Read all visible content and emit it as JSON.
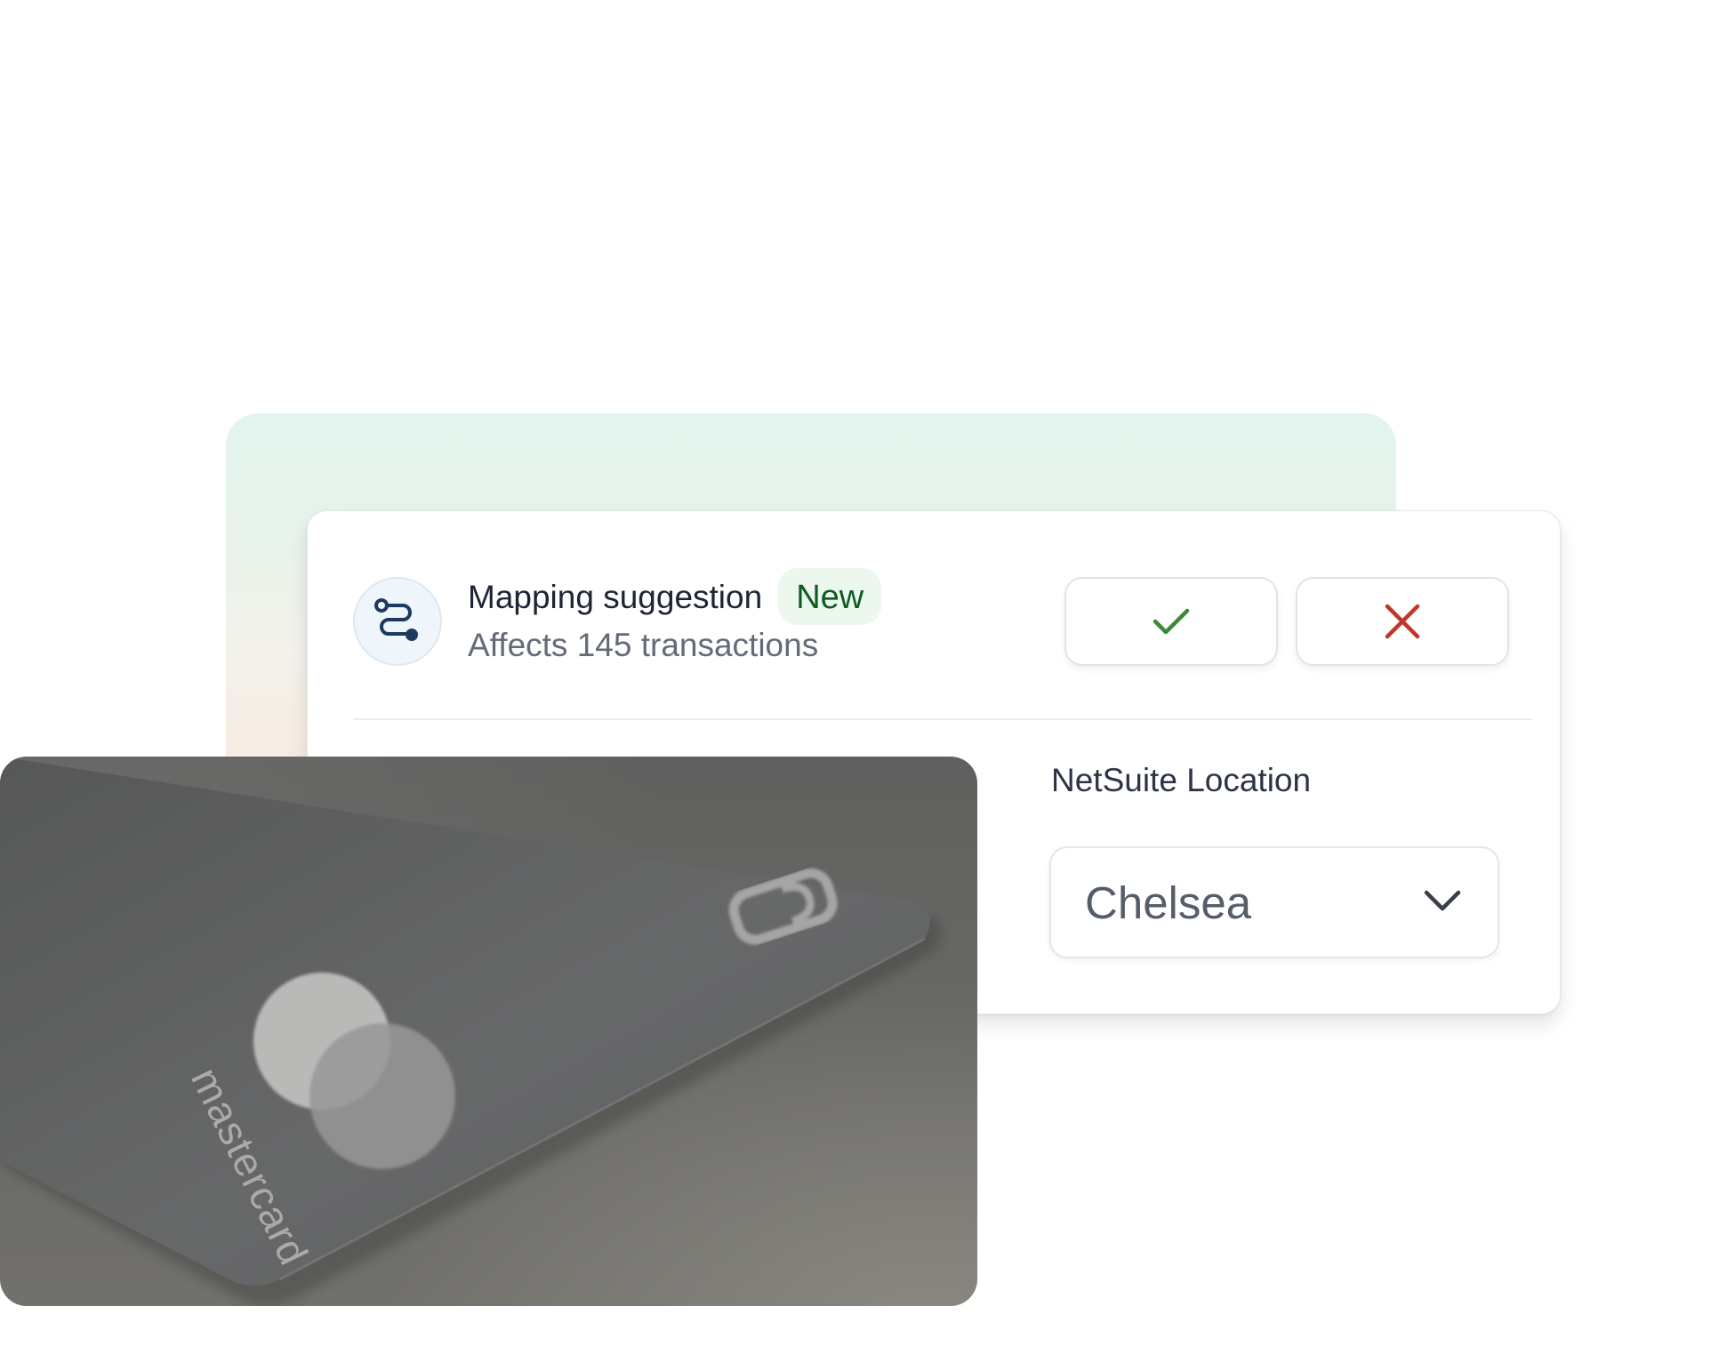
{
  "mapping": {
    "title": "Mapping suggestion",
    "badge": "New",
    "subtitle": "Affects 145 transactions",
    "icon": "route-icon",
    "accept_icon": "check-icon",
    "reject_icon": "close-icon"
  },
  "location_field": {
    "label": "NetSuite Location",
    "value": "Chelsea",
    "icon": "chevron-down-icon"
  },
  "photo": {
    "card_text": "mastercard"
  },
  "colors": {
    "accept": "#3a8a3a",
    "reject": "#c0362c",
    "badge_bg": "#ecf8ee",
    "badge_text": "#0e5b22",
    "route_icon": "#1e3a5f"
  }
}
